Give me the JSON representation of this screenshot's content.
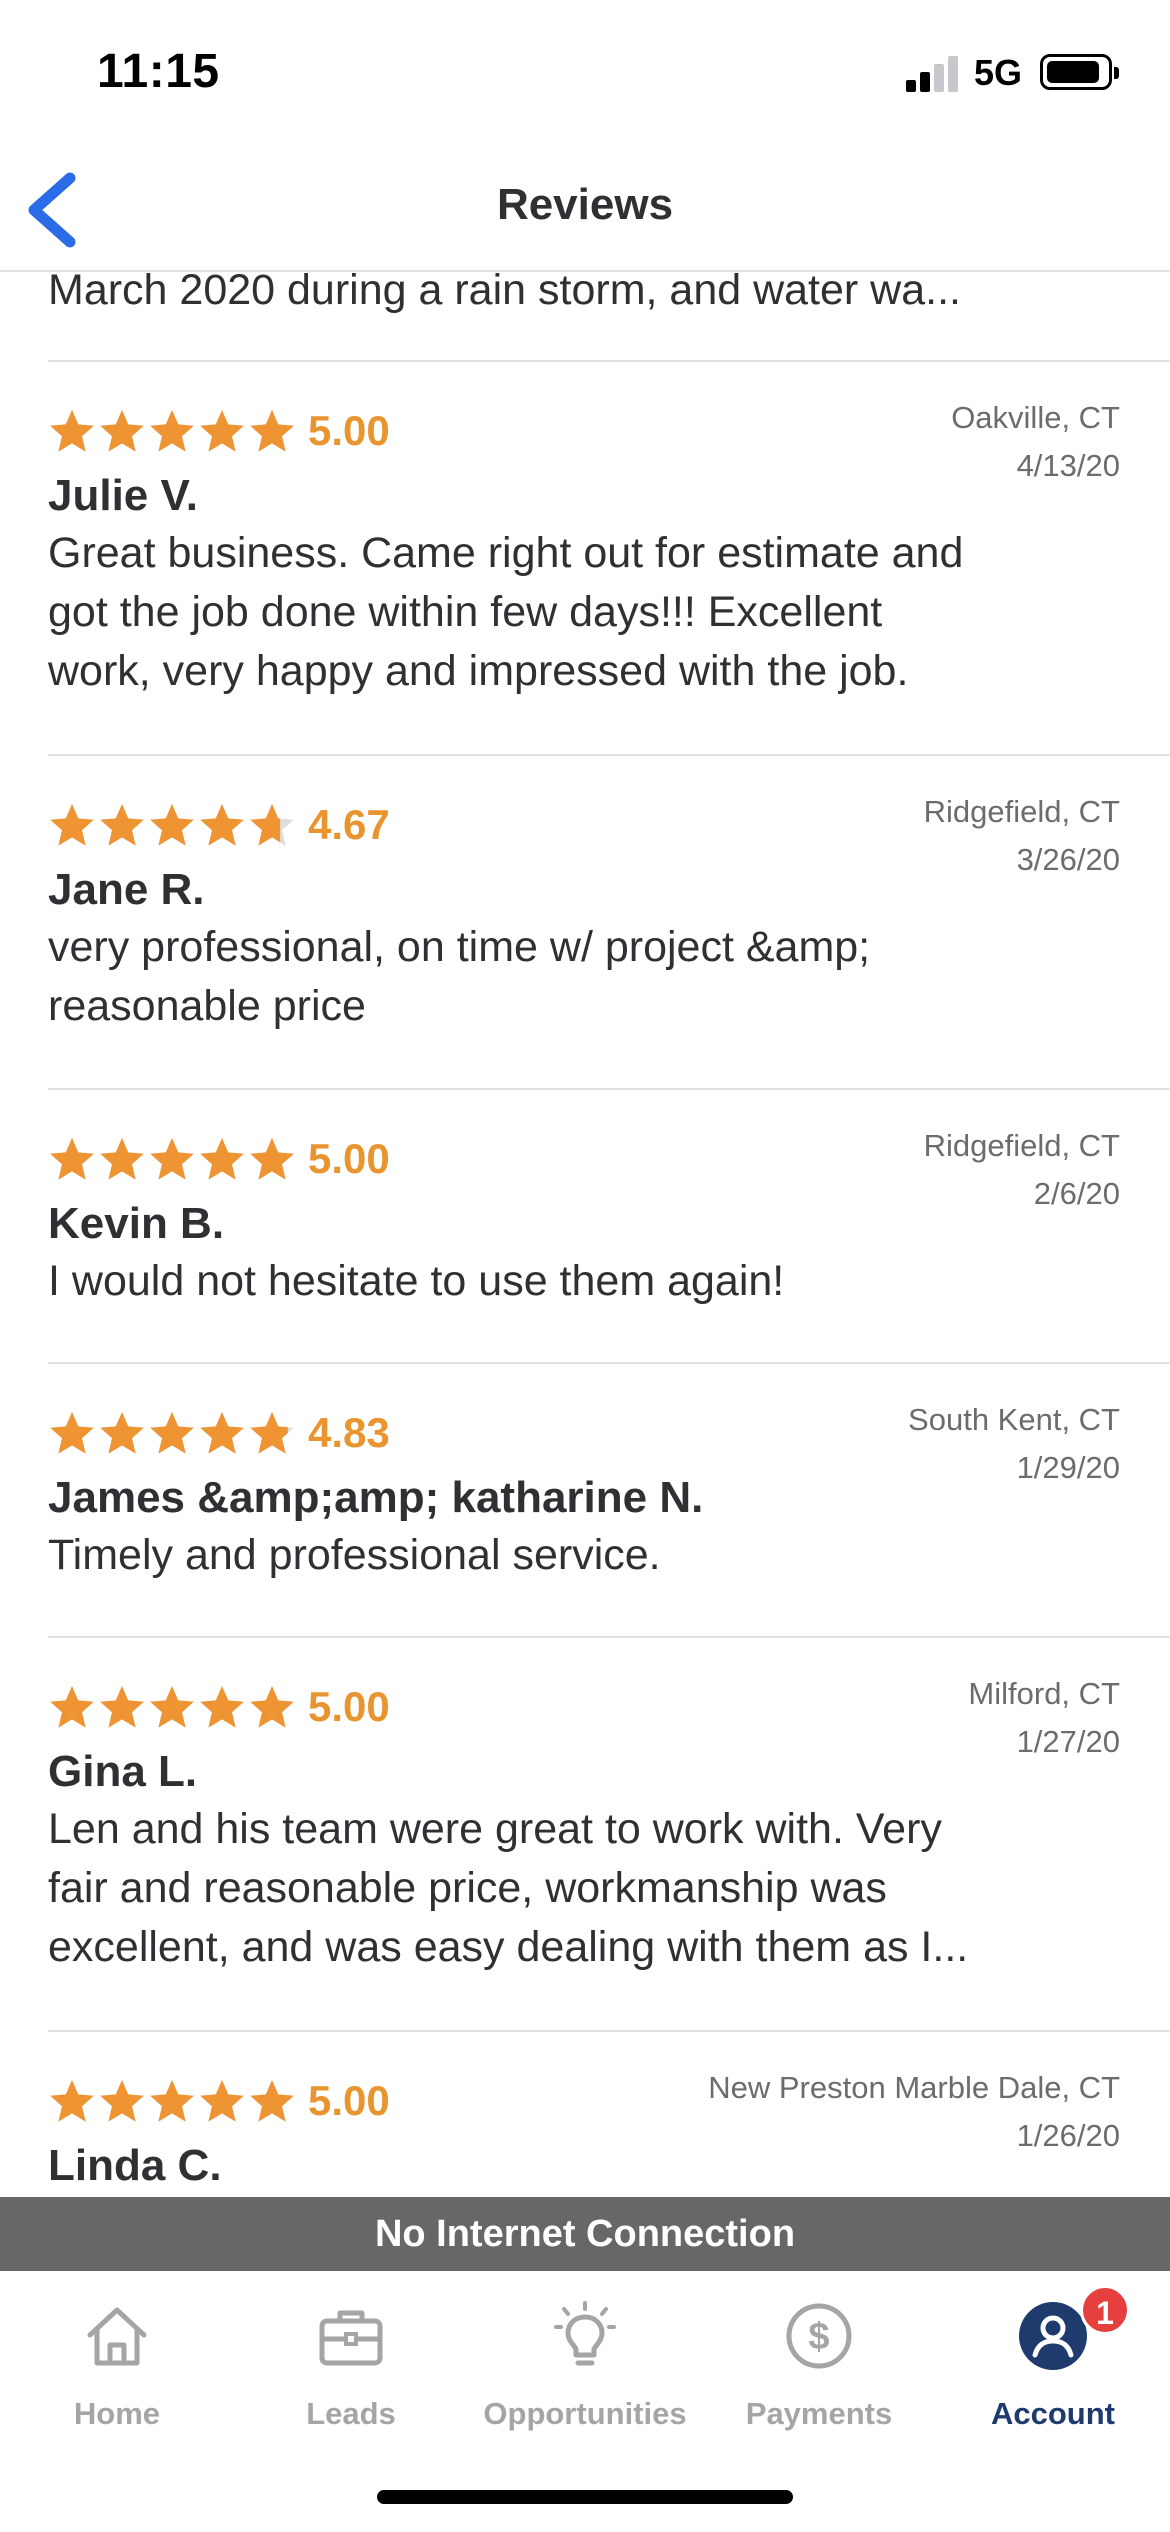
{
  "status_bar": {
    "time": "11:15",
    "network": "5G"
  },
  "header": {
    "title": "Reviews"
  },
  "partial_review_text": "March 2020 during a rain storm, and water wa...",
  "colors": {
    "star": "#EE9433",
    "rating": "#E8952F",
    "accent": "#1F3B6E",
    "back": "#2B6BE8",
    "badge": "#E5403E"
  },
  "reviews": [
    {
      "stars": 5.0,
      "rating": "5.00",
      "location": "Oakville, CT",
      "date": "4/13/20",
      "name": "Julie V.",
      "lines": [
        "Great business. Came right out for estimate and",
        "got the job done within few days!!! Excellent",
        "work, very happy and impressed with the job."
      ]
    },
    {
      "stars": 4.67,
      "rating": "4.67",
      "location": "Ridgefield, CT",
      "date": "3/26/20",
      "name": "Jane R.",
      "lines": [
        "very professional, on time w/ project &amp;",
        "reasonable price"
      ]
    },
    {
      "stars": 5.0,
      "rating": "5.00",
      "location": "Ridgefield, CT",
      "date": "2/6/20",
      "name": "Kevin B.",
      "lines": [
        "I would not hesitate to use them again!"
      ]
    },
    {
      "stars": 4.83,
      "rating": "4.83",
      "location": "South Kent, CT",
      "date": "1/29/20",
      "name": "James &amp;amp; katharine N.",
      "lines": [
        "Timely and professional service."
      ]
    },
    {
      "stars": 5.0,
      "rating": "5.00",
      "location": "Milford, CT",
      "date": "1/27/20",
      "name": "Gina L.",
      "lines": [
        "Len and his team were great to work with. Very",
        "fair and reasonable price, workmanship was",
        "excellent, and was easy dealing with them as I..."
      ]
    },
    {
      "stars": 5.0,
      "rating": "5.00",
      "location": "New Preston Marble Dale, CT",
      "date": "1/26/20",
      "name": "Linda C.",
      "lines": []
    }
  ],
  "banner": {
    "text": "No Internet Connection"
  },
  "tabs": [
    {
      "label": "Home",
      "icon": "home-icon"
    },
    {
      "label": "Leads",
      "icon": "briefcase-icon"
    },
    {
      "label": "Opportunities",
      "icon": "lightbulb-icon"
    },
    {
      "label": "Payments",
      "icon": "dollar-icon"
    },
    {
      "label": "Account",
      "icon": "account-icon",
      "badge": "1",
      "active": true
    }
  ]
}
